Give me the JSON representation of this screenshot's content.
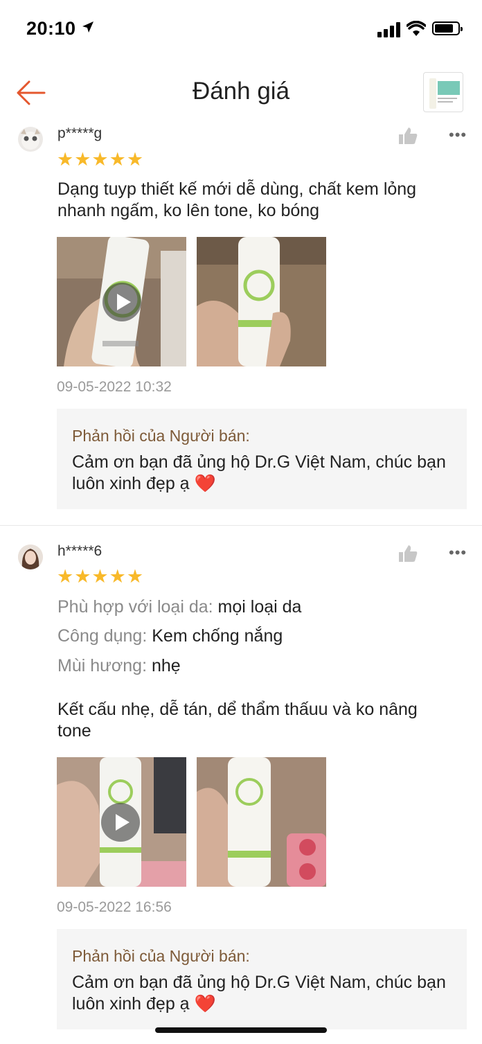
{
  "status_bar": {
    "time": "20:10"
  },
  "header": {
    "title": "Đánh giá"
  },
  "reviews": [
    {
      "username": "p*****g",
      "stars": "★★★★★",
      "rating": 5,
      "text": "Dạng tuyp thiết kế mới dễ dùng, chất kem lỏng nhanh ngấm, ko lên tone, ko bóng",
      "date": "09-05-2022 10:32",
      "reply_title": "Phản hồi của Người bán:",
      "reply_text": "Cảm ơn bạn đã ủng hộ Dr.G Việt Nam, chúc bạn luôn xinh đẹp ạ ❤️",
      "more": "•••"
    },
    {
      "username": "h*****6",
      "stars": "★★★★★",
      "rating": 5,
      "attributes": [
        {
          "label": "Phù hợp với loại da:",
          "value": "mọi loại da"
        },
        {
          "label": "Công dụng:",
          "value": "Kem chống nắng"
        },
        {
          "label": "Mùi hương:",
          "value": "nhẹ"
        }
      ],
      "text": "Kết cấu nhẹ, dễ tán, dể thẩm thấuu và ko nâng tone",
      "date": "09-05-2022 16:56",
      "reply_title": "Phản hồi của Người bán:",
      "reply_text": "Cảm ơn bạn đã ủng hộ Dr.G Việt Nam, chúc bạn luôn xinh đẹp ạ ❤️",
      "more": "•••"
    }
  ],
  "colors": {
    "accent": "#e4572e",
    "star": "#f8b92a",
    "reply_title": "#7d5a38"
  }
}
